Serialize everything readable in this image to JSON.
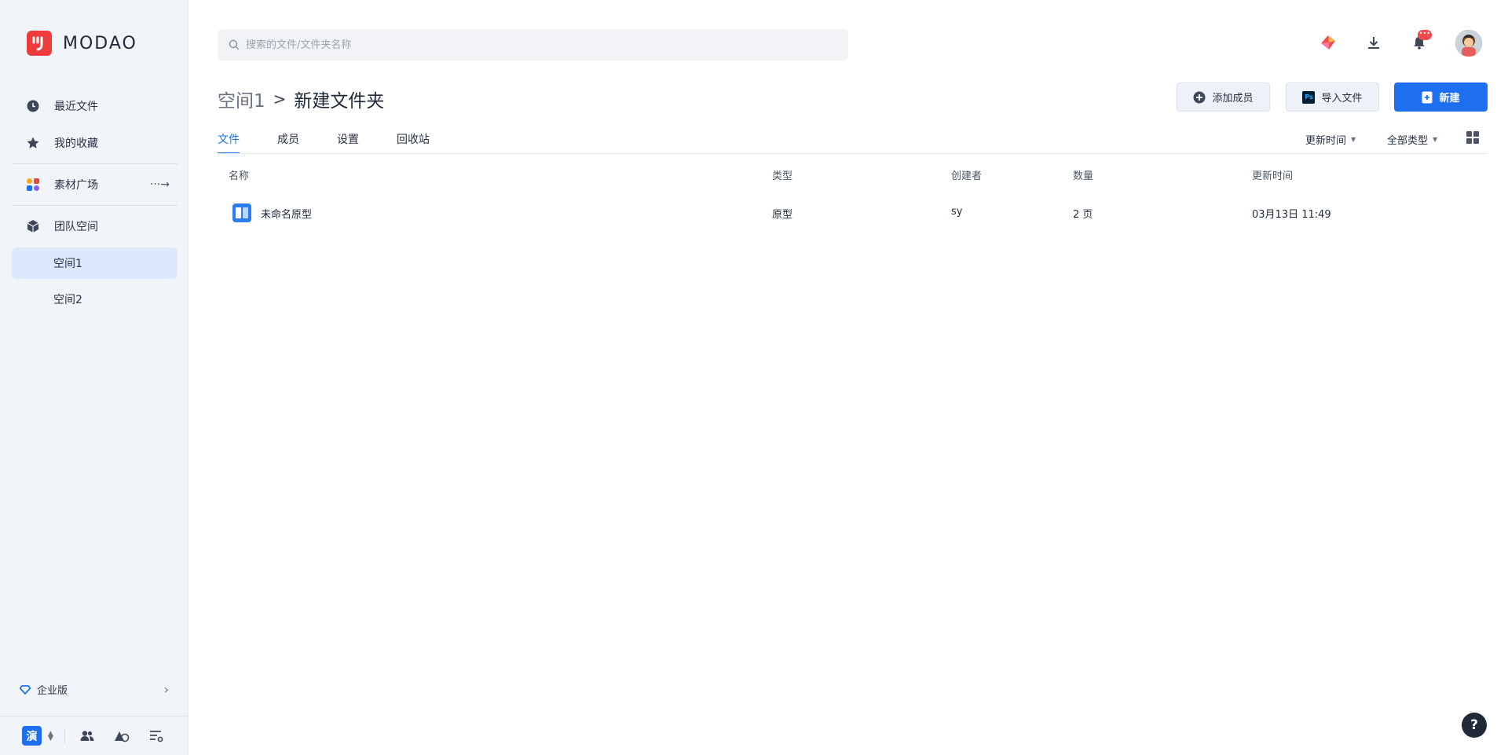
{
  "brand": {
    "name": "MODAO",
    "accent": "#1e6ff0",
    "logo_color": "#ee3b3b"
  },
  "sidebar": {
    "recent": "最近文件",
    "favorites": "我的收藏",
    "materials": "素材广场",
    "materials_arrow": "···→",
    "team": "团队空间",
    "spaces": [
      "空间1",
      "空间2"
    ],
    "enterprise": "企业版",
    "workspace_badge": "演"
  },
  "search": {
    "placeholder": "搜索的文件/文件夹名称"
  },
  "header": {
    "breadcrumb_parent": "空间1",
    "breadcrumb_sep": ">",
    "breadcrumb_current": "新建文件夹",
    "add_member": "添加成员",
    "import_file": "导入文件",
    "new": "新建",
    "import_badge": "Ps"
  },
  "notifications": {
    "badge": "•••"
  },
  "tabs": [
    "文件",
    "成员",
    "设置",
    "回收站"
  ],
  "filters": {
    "sort": "更新时间",
    "type": "全部类型"
  },
  "table": {
    "columns": [
      "名称",
      "类型",
      "创建者",
      "数量",
      "更新时间"
    ],
    "rows": [
      {
        "name": "未命名原型",
        "type": "原型",
        "creator": "sy",
        "count": "2 页",
        "updated": "03月13日 11:49"
      }
    ]
  },
  "help": "?"
}
